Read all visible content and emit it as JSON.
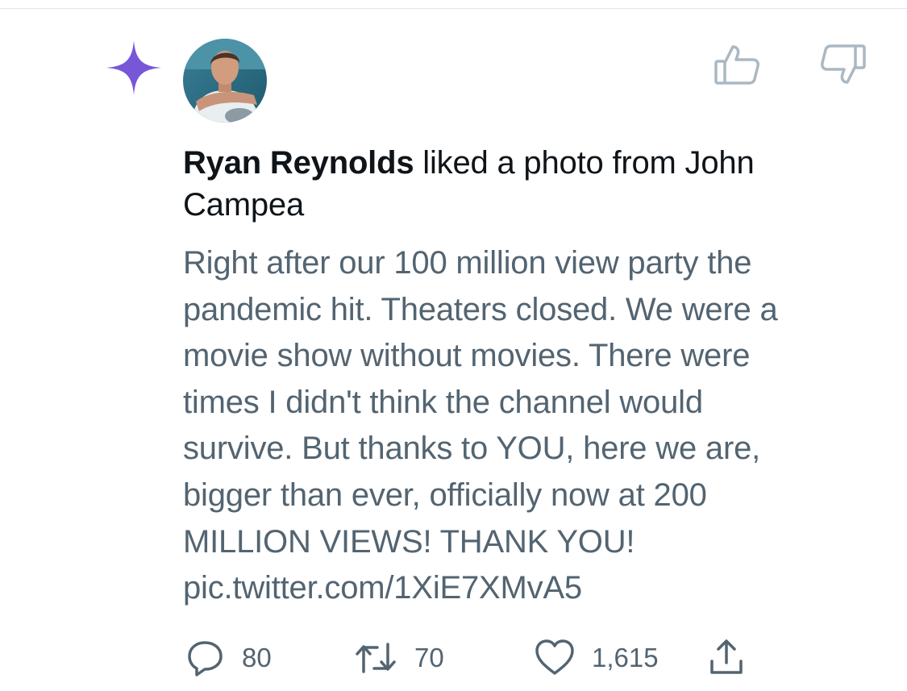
{
  "notification": {
    "actor_name": "Ryan Reynolds",
    "action_text": " liked a photo from John Campea",
    "body_lines": [
      "Right after our 100 million view party the",
      "pandemic hit. Theaters closed. We were a",
      "movie show without movies. There were",
      "times I didn't think the channel would",
      "survive. But thanks to YOU, here we are,",
      "bigger than ever, officially now at 200",
      "MILLION VIEWS! THANK YOU!",
      "pic.twitter.com/1XiE7XMvA5"
    ]
  },
  "stats": {
    "replies": "80",
    "retweets": "70",
    "likes": "1,615"
  },
  "icons": {
    "sparkle": "sparkle-icon",
    "thumbs_up": "thumbs-up-icon",
    "thumbs_down": "thumbs-down-icon",
    "reply": "reply-icon",
    "retweet": "retweet-icon",
    "like": "heart-icon",
    "share": "share-icon"
  },
  "colors": {
    "sparkle": "#7856d8",
    "text_primary": "#0f1419",
    "text_secondary": "#536471",
    "feedback_icon": "#aab8c2"
  }
}
